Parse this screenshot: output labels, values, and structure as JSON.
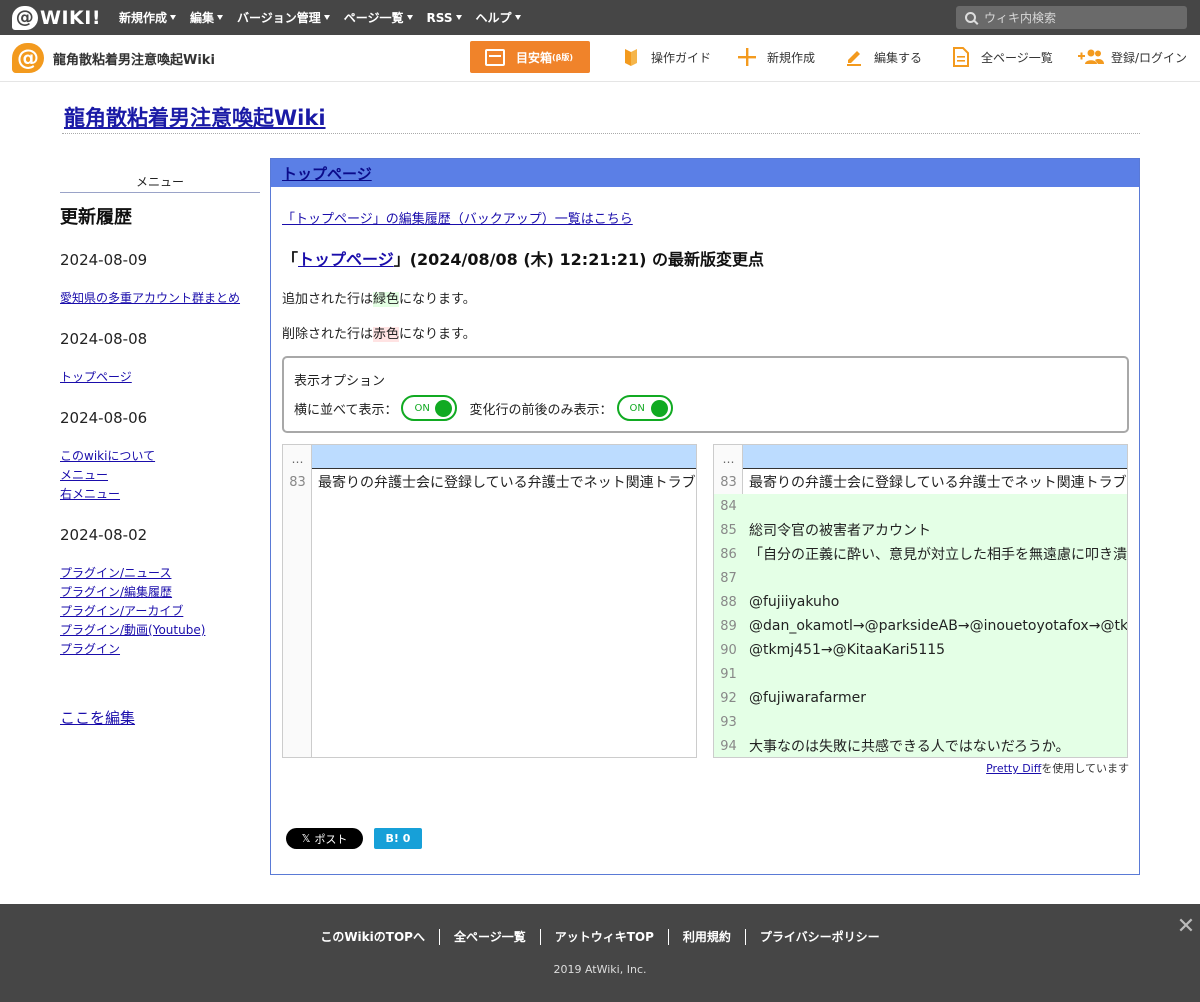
{
  "topbar": {
    "logo_text": "WIKI!",
    "nav": [
      "新規作成",
      "編集",
      "バージョン管理",
      "ページ一覧",
      "RSS",
      "ヘルプ"
    ],
    "search_placeholder": "ウィキ内検索"
  },
  "subbar": {
    "wiki_name": "龍角散粘着男注意喚起Wiki",
    "meyasu_label": "目安箱",
    "meyasu_suffix": "(β版)",
    "tools": [
      "操作ガイド",
      "新規作成",
      "編集する",
      "全ページ一覧",
      "登録/ログイン"
    ]
  },
  "page_title": "龍角散粘着男注意喚起Wiki",
  "sidebar": {
    "menu_caption": "メニュー",
    "heading": "更新履歴",
    "groups": [
      {
        "date": "2024-08-09",
        "links": [
          "愛知県の多重アカウント群まとめ"
        ]
      },
      {
        "date": "2024-08-08",
        "links": [
          "トップページ"
        ]
      },
      {
        "date": "2024-08-06",
        "links": [
          "このwikiについて",
          "メニュー",
          "右メニュー"
        ]
      },
      {
        "date": "2024-08-02",
        "links": [
          "プラグイン/ニュース",
          "プラグイン/編集履歴",
          "プラグイン/アーカイブ",
          "プラグイン/動画(Youtube)",
          "プラグイン"
        ]
      }
    ],
    "edit_link": "ここを編集"
  },
  "main": {
    "header_link": "トップページ",
    "backup_link": "「トップページ」の編集履歴（バックアップ）一覧はこちら",
    "diff_prefix": "「",
    "diff_page": "トップページ",
    "diff_suffix": "」(2024/08/08 (木) 12:21:21) の最新版変更点",
    "added_note_pre": "追加された行は",
    "added_note_word": "緑色",
    "added_note_post": "になります。",
    "deleted_note_pre": "削除された行は",
    "deleted_note_word": "赤色",
    "deleted_note_post": "になります。",
    "options_caption": "表示オプション",
    "opt_side_by_side": "横に並べて表示：",
    "opt_changed_only": "変化行の前後のみ表示：",
    "toggle_on": "ON",
    "dots": "…",
    "left_lines": [
      {
        "num": "83",
        "text": "最寄りの弁護士会に登録している弁護士でネット関連トラブル"
      }
    ],
    "right_lines": [
      {
        "num": "83",
        "text": "最寄りの弁護士会に登録している弁護士でネット関連トラブル",
        "ins": false
      },
      {
        "num": "84",
        "text": "",
        "ins": true
      },
      {
        "num": "85",
        "text": "総司令官の被害者アカウント",
        "ins": true
      },
      {
        "num": "86",
        "text": "「自分の正義に酔い、意見が対立した相手を無遠慮に叩き潰",
        "ins": true
      },
      {
        "num": "87",
        "text": "",
        "ins": true
      },
      {
        "num": "88",
        "text": "@fujiiyakuho",
        "ins": true
      },
      {
        "num": "89",
        "text": "@dan_okamotl→@parksideAB→@inouetoyotafox→@tkm",
        "ins": true
      },
      {
        "num": "90",
        "text": "@tkmj451→@KitaaKari5115",
        "ins": true
      },
      {
        "num": "91",
        "text": "",
        "ins": true
      },
      {
        "num": "92",
        "text": "@fujiwarafarmer",
        "ins": true
      },
      {
        "num": "93",
        "text": "",
        "ins": true
      },
      {
        "num": "94",
        "text": "大事なのは失敗に共感できる人ではないだろうか。",
        "ins": true
      }
    ],
    "pretty_link": "Pretty Diff",
    "pretty_suffix": "を使用しています",
    "xpost_label": "ポスト",
    "hatena_label": "B! 0"
  },
  "footer": {
    "links": [
      "このWikiのTOPへ",
      "全ページ一覧",
      "アットウィキTOP",
      "利用規約",
      "プライバシーポリシー"
    ],
    "copyright": "2019 AtWiki, Inc."
  },
  "colors": {
    "accent_orange": "#f0832a",
    "header_blue": "#5b7fe6",
    "added_green": "#e4ffe6",
    "toggle_green": "#11aa22"
  }
}
